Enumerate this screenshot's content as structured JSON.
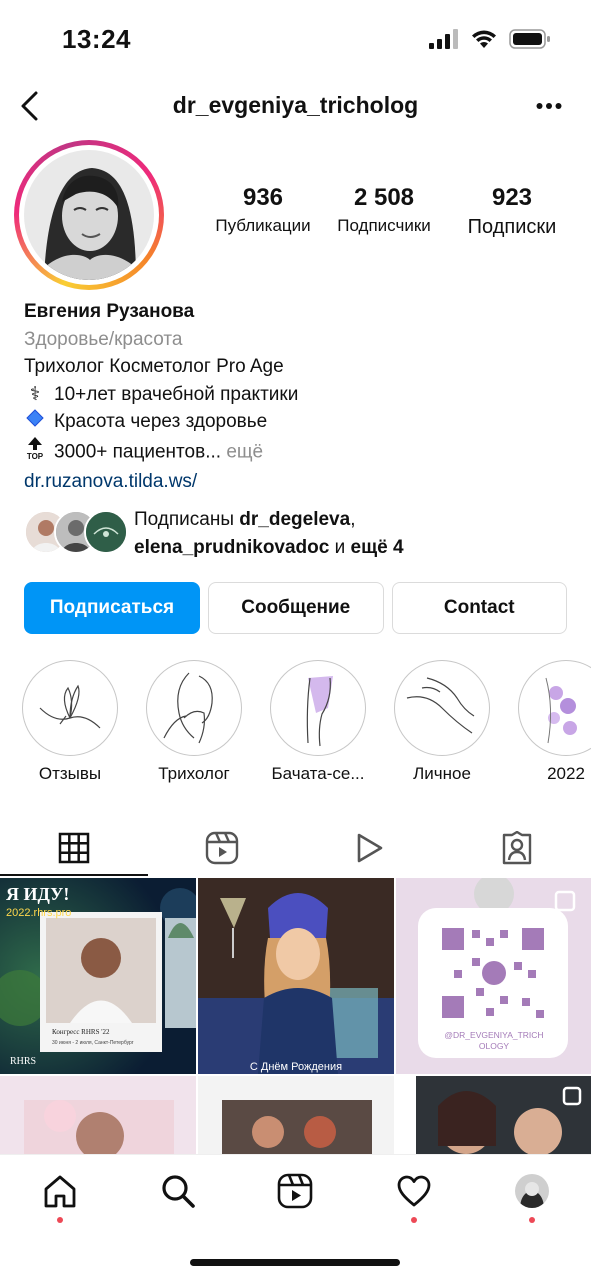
{
  "status_bar": {
    "time": "13:24"
  },
  "header": {
    "username": "dr_evgeniya_tricholog"
  },
  "stats": [
    {
      "value": "936",
      "label": "Публикации"
    },
    {
      "value": "2 508",
      "label": "Подписчики"
    },
    {
      "value": "923",
      "label": "Подписки"
    }
  ],
  "bio": {
    "name": "Евгения Рузанова",
    "category": "Здоровье/красота",
    "line1": "Трихолог Косметолог Pro Age",
    "line2": "10+лет врачебной практики",
    "line3": "Красота через здоровье",
    "line4": "3000+ пациентов...",
    "more": " ещё",
    "link": "dr.ruzanova.tilda.ws/",
    "top_badge": "TOP"
  },
  "followed_by": {
    "prefix": "Подписаны ",
    "user1": "dr_degeleva",
    "sep": ",",
    "user2": "elena_prudnikovadoc",
    "mid": " и ",
    "rest": "ещё 4"
  },
  "buttons": {
    "follow": "Подписаться",
    "message": "Сообщение",
    "contact": "Contact"
  },
  "highlights": [
    {
      "label": "Отзывы"
    },
    {
      "label": "Трихолог"
    },
    {
      "label": "Бачата-се..."
    },
    {
      "label": "Личное"
    },
    {
      "label": "2022"
    }
  ],
  "posts": {
    "p1_title": "Я ИДУ!",
    "p1_site": "2022.rhrs.pro",
    "p1_caption": "Конгресс RHRS '22",
    "p1_sub": "30 июня - 2 июля, Санкт-Петербург",
    "p1_logo": "RHRS",
    "p2_caption": "С Днём Рождения",
    "p3_handle": "@DR_EVGENIYA_TRICH\nOLOGY"
  },
  "colors": {
    "accent": "#0095f6",
    "link": "#00376b",
    "muted": "#8e8e8e",
    "notification_dot": "#ed4956"
  }
}
